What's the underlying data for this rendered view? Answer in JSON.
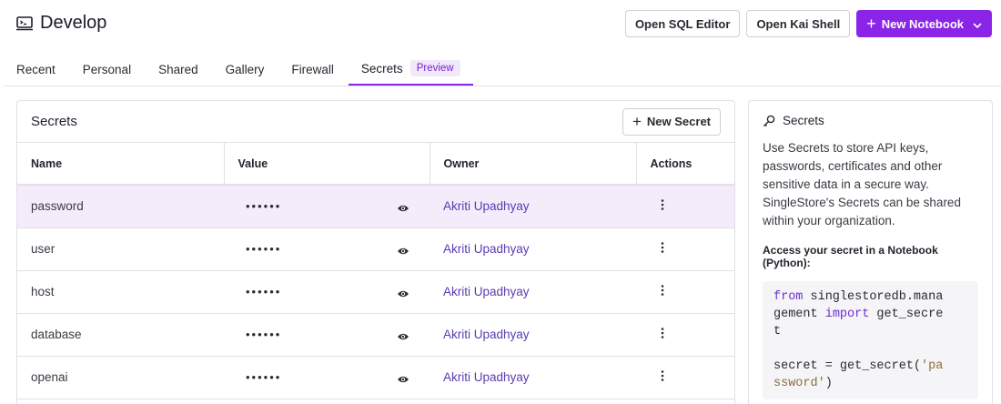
{
  "header": {
    "title": "Develop",
    "icon": "terminal-icon",
    "buttons": {
      "sql_editor": "Open SQL Editor",
      "kai_shell": "Open Kai Shell",
      "new_notebook": "New Notebook"
    },
    "accent_color": "#8a24e6"
  },
  "tabs": [
    {
      "label": "Recent"
    },
    {
      "label": "Personal"
    },
    {
      "label": "Shared"
    },
    {
      "label": "Gallery"
    },
    {
      "label": "Firewall"
    },
    {
      "label": "Secrets",
      "badge": "Preview",
      "active": true
    }
  ],
  "secrets_panel": {
    "title": "Secrets",
    "new_button": "New Secret",
    "columns": [
      "Name",
      "Value",
      "Owner",
      "Actions"
    ],
    "rows": [
      {
        "name": "password",
        "value": "••••••",
        "owner": "Akriti Upadhyay",
        "selected": true
      },
      {
        "name": "user",
        "value": "••••••",
        "owner": "Akriti Upadhyay"
      },
      {
        "name": "host",
        "value": "••••••",
        "owner": "Akriti Upadhyay"
      },
      {
        "name": "database",
        "value": "••••••",
        "owner": "Akriti Upadhyay"
      },
      {
        "name": "openai",
        "value": "••••••",
        "owner": "Akriti Upadhyay"
      }
    ]
  },
  "info_panel": {
    "title": "Secrets",
    "description": "Use Secrets to store API keys, passwords, certificates and other sensitive data in a secure way. SingleStore's Secrets can be shared within your organization.",
    "subheading": "Access your secret in a Notebook (Python):",
    "code": {
      "l1_kw": "from",
      "l1_rest": " singlestoredb.mana",
      "l2_a": "gement ",
      "l2_kw": "import",
      "l2_b": " get_secre",
      "l3": "t",
      "l5_a": "secret = get_secret(",
      "l5_str": "'pa",
      "l6_str": "ssword'",
      "l6_b": ")"
    }
  }
}
